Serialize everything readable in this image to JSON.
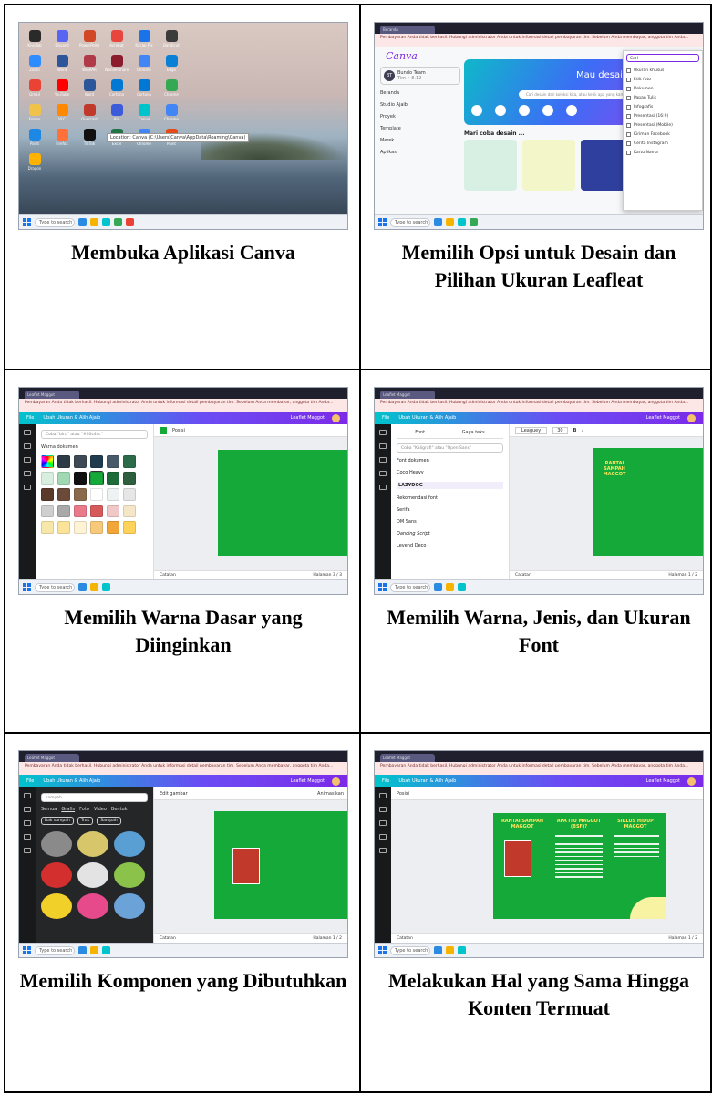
{
  "captions": [
    "Membuka Aplikasi Canva",
    "Memilih Opsi untuk Desain dan Pilihan Ukuran Leafleat",
    "Memilih Warna Dasar yang Diinginkan",
    "Memilih Warna, Jenis, dan Ukuran Font",
    "Memilih Komponen yang Dibutuhkan",
    "Melakukan Hal yang Sama Hingga Konten Termuat"
  ],
  "taskbar": {
    "search_placeholder": "Type to search"
  },
  "browser": {
    "notice": "Pembayaran Anda tidak berhasil. Hubungi administrator Anda untuk informasi detail pembayaran tim. Sebelum Anda membayar, anggota tim Anda...",
    "tab_home": "Beranda",
    "tab_leaflet": "Leaflet Maggot"
  },
  "desktop": {
    "icons": [
      "KiyoTab",
      "Discord",
      "PowerPoint",
      "Acrobat",
      "Kacap Pix",
      "",
      "Bandicut",
      "Zoom",
      "Word",
      "WinRAR",
      "Wondershare",
      "",
      "Chrome",
      "Edge",
      "Gmail",
      "YouTube",
      "Word",
      "Cortana",
      "",
      "Cortana",
      "Chrome",
      "Folder",
      "VLC",
      "",
      "Overcast",
      "Arc",
      "Canva",
      "Chrome",
      "Paint",
      "Firefox",
      "TikTok",
      "",
      "Excel",
      "Chrome",
      "Paint",
      "Dragon"
    ],
    "tooltip": "Location: Canva (C:\\Users\\Canva\\AppData\\Roaming\\Canva)"
  },
  "home": {
    "logo": "Canva",
    "team": "Bundo Team",
    "team_sub": "Tim • 8.12",
    "nav": [
      "Beranda",
      "Studio Ajaib",
      "Proyek",
      "Template",
      "Merek",
      "Aplikasi"
    ],
    "banner_title": "Mau desain apa",
    "banner_search": "Cari desain dari koleksi kita, atau ketik apa yang kamu mau",
    "suggest": "Mari coba desain ...",
    "dropdown_search": "Cari",
    "dropdown_items": [
      "Ukuran khusus",
      "Edit foto",
      "Dokumen",
      "Papan Tulis",
      "Infografis",
      "Presentasi (16:9)",
      "Presentasi (Mobile)",
      "Kiriman Facebook",
      "Cerita Instagram",
      "Kartu Nama"
    ]
  },
  "editor": {
    "menu_file": "File",
    "resize": "Ubah Ukuran & Alih Ajaib",
    "doc_title": "Leaflet Maggot",
    "share": "Bagikan",
    "notes": "Catatan",
    "page_3": "Halaman 3 / 3",
    "page_1": "Halaman 1 / 2",
    "position": "Posisi",
    "color_search": "Coba \"biru\" atau \"#00c4cc\"",
    "doc_colors": "Warna dokumen",
    "font_tab": "Font",
    "style_tab": "Gaya teks",
    "font_search": "Coba \"Kaligrafi\" atau \"Open Sans\"",
    "font_name": "Leaguey",
    "font_size": "30",
    "fonts": [
      "Font dokumen",
      "Coco Heavy",
      "LAZYDOG",
      "Rekomendasi font",
      "Serifa",
      "DM Sans",
      "Dancing Script",
      "Levend Deco"
    ],
    "elem_search": "sampah",
    "elem_tabs": [
      "Semua",
      "Grafis",
      "Foto",
      "Video",
      "Bentuk"
    ],
    "elem_chips": [
      "Bak sampah",
      "Truk",
      "Sampah"
    ],
    "edit_image": "Edit gambar",
    "animate": "Animasikan",
    "leaflet_titles": [
      "RANTAI SAMPAH MAGGOT",
      "APA ITU MAGGOT (BSF)?",
      "SIKLUS HIDUP MAGGOT"
    ]
  }
}
